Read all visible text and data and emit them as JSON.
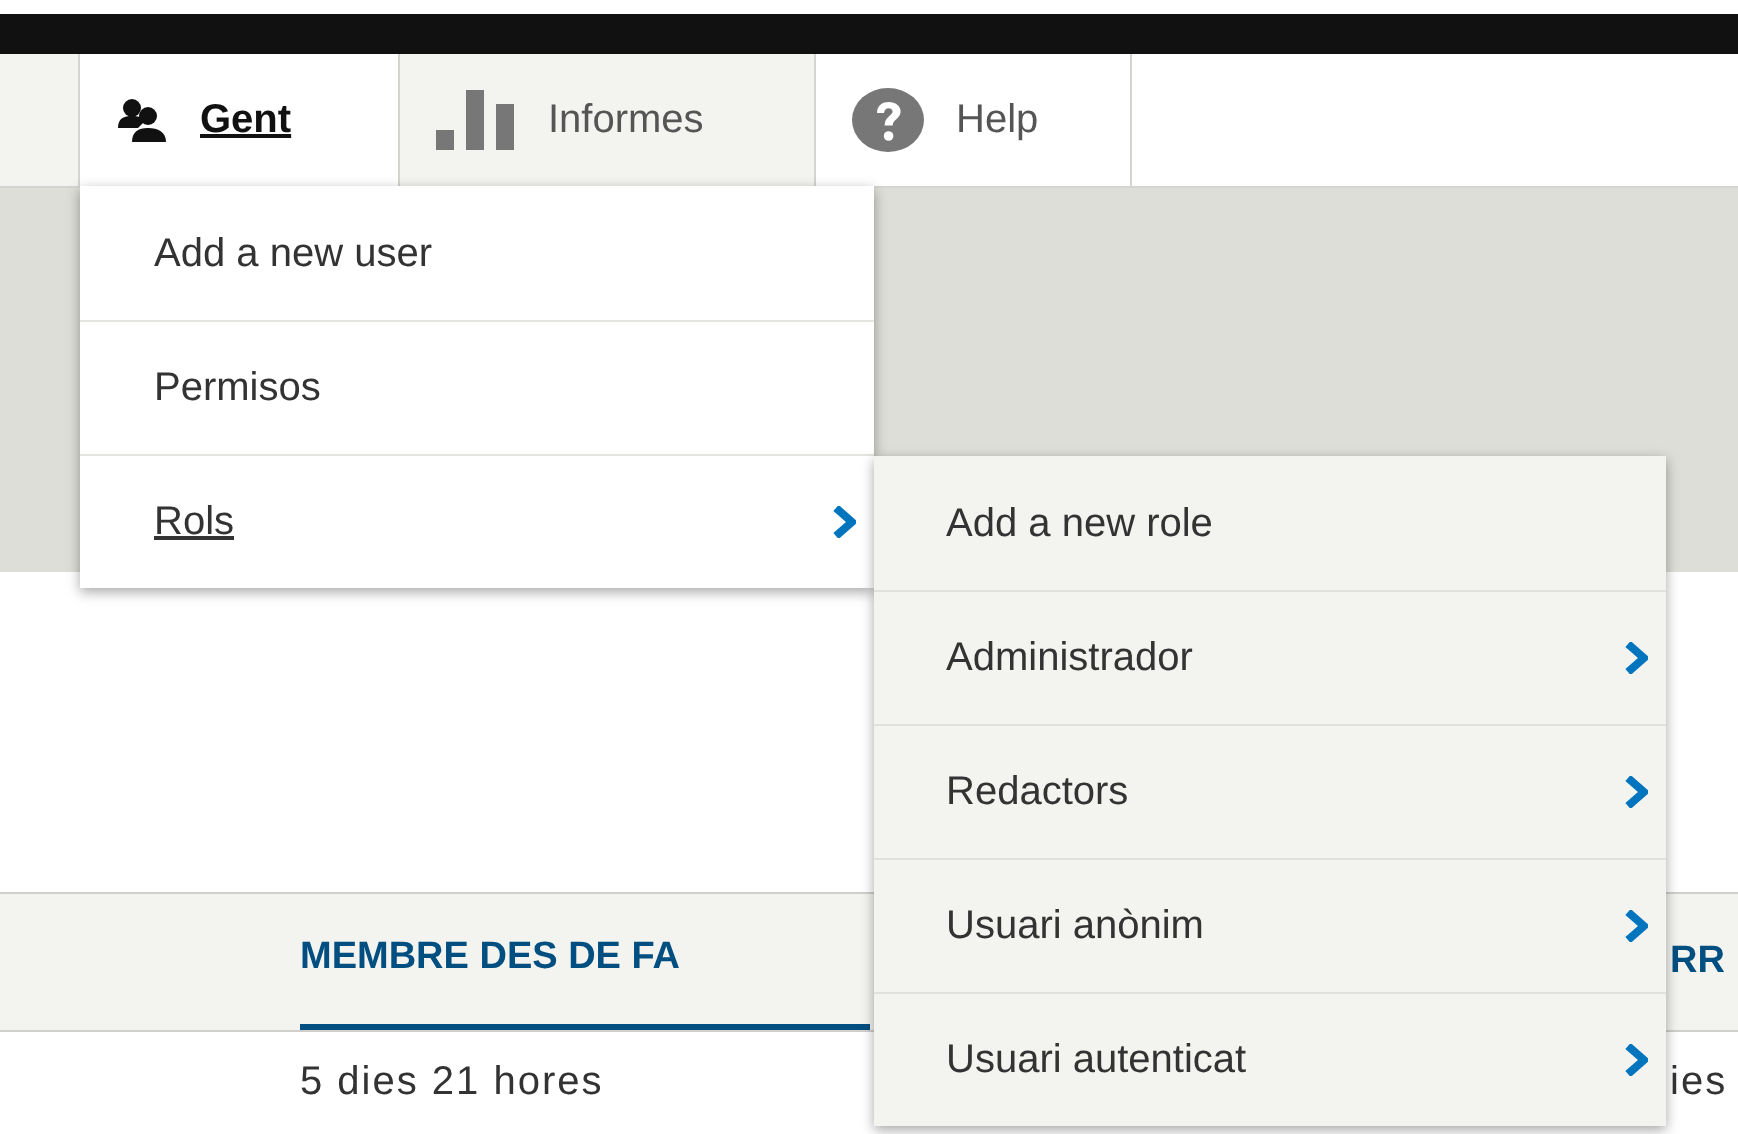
{
  "toolbar": {
    "tabs": [
      {
        "label": "Gent",
        "kind": "people",
        "selected": true,
        "hovered": false
      },
      {
        "label": "Informes",
        "kind": "chart",
        "selected": false,
        "hovered": true
      },
      {
        "label": "Help",
        "kind": "help",
        "selected": false,
        "hovered": false
      }
    ]
  },
  "menu": {
    "items": [
      {
        "label": "Add a new user",
        "selected": false,
        "has_submenu": false
      },
      {
        "label": "Permisos",
        "selected": false,
        "has_submenu": false
      },
      {
        "label": "Rols",
        "selected": true,
        "has_submenu": true
      }
    ]
  },
  "submenu": {
    "items": [
      {
        "label": "Add a new role",
        "has_submenu": false
      },
      {
        "label": "Administrador",
        "has_submenu": true
      },
      {
        "label": "Redactors",
        "has_submenu": true
      },
      {
        "label": "Usuari anònim",
        "has_submenu": true
      },
      {
        "label": "Usuari autenticat",
        "has_submenu": true
      }
    ]
  },
  "table": {
    "columns": [
      {
        "label": "MEMBRE DES DE FA",
        "sorted": true
      },
      {
        "label": "RR",
        "sorted": false
      }
    ],
    "rows": [
      [
        "5 dies 21 hores",
        "ies"
      ]
    ]
  }
}
